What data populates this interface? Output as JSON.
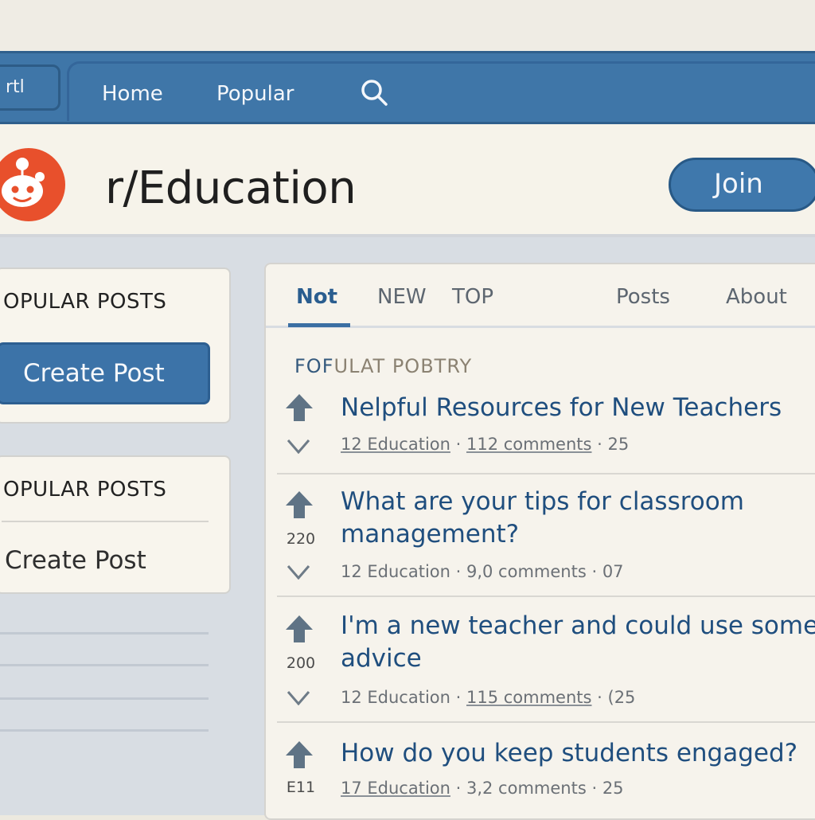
{
  "navbar": {
    "search_box_text": "rtl",
    "home": "Home",
    "popular": "Popular",
    "search_icon": "search-icon"
  },
  "header": {
    "logo_icon": "reddit-alien-icon",
    "community_name": "r/Education",
    "join_label": "Join"
  },
  "sidebar": {
    "card1": {
      "heading": "OPULAR POSTS",
      "create_post": "Create Post"
    },
    "card2": {
      "heading": "OPULAR POSTS",
      "create_post": "Create Post"
    }
  },
  "tabs": [
    "Not",
    "NEW",
    "TOP",
    "Posts",
    "About"
  ],
  "feed": {
    "heading_prefix": "FOF",
    "heading_rest": "ULAT POBTRY",
    "posts": [
      {
        "votes": "",
        "title": "Nelpful Resources for New Teachers",
        "community": "12 Education",
        "comments": "112 comments",
        "age": "25"
      },
      {
        "votes": "220",
        "title": "What are your tips for classroom management?",
        "community": "12 Education",
        "comments": "9,0 comments",
        "age": "07"
      },
      {
        "votes": "200",
        "title": "I'm a new teacher and could use some advice",
        "community": "12 Education",
        "comments": "115 comments",
        "age": "(25"
      },
      {
        "votes": "E11",
        "title": "How do you keep students engaged?",
        "community": "17 Education",
        "comments": "3,2 comments",
        "age": "25"
      }
    ]
  },
  "colors": {
    "navbar": "#3f76a8",
    "accent": "#3f78ac",
    "logo": "#e8502c",
    "title_text": "#1f4e7e"
  }
}
